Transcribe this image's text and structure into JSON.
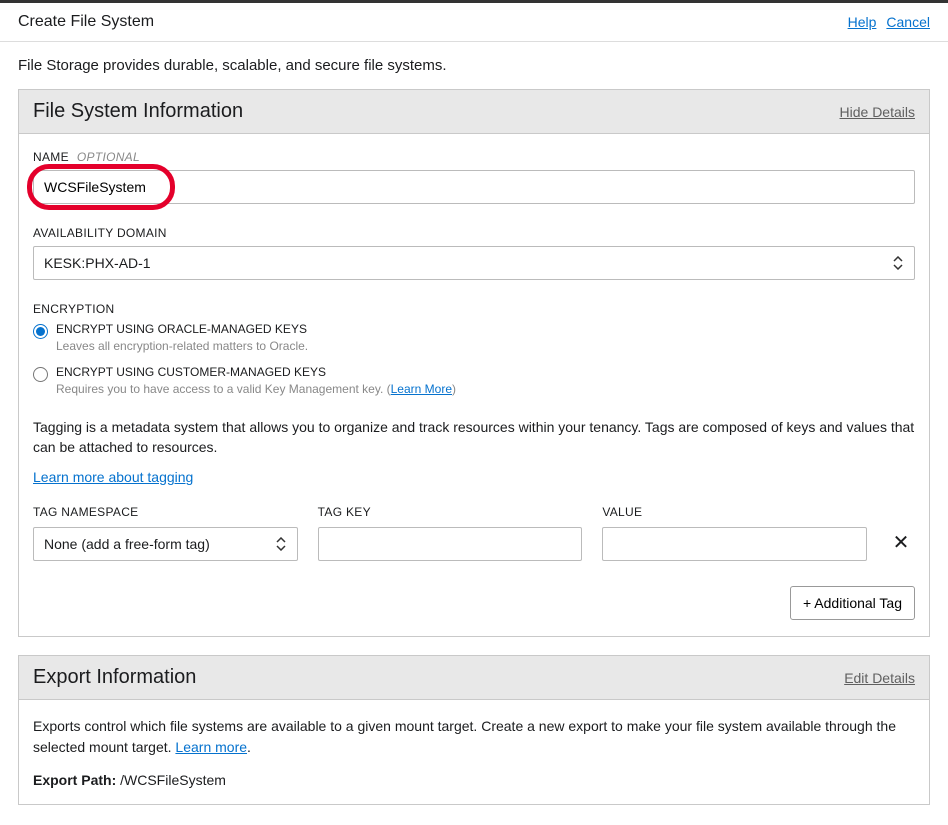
{
  "header": {
    "title": "Create File System",
    "help_label": "Help",
    "cancel_label": "Cancel"
  },
  "intro": "File Storage provides durable, scalable, and secure file systems.",
  "fs_section": {
    "title": "File System Information",
    "toggle_label": "Hide Details",
    "name": {
      "label": "NAME",
      "optional": "OPTIONAL",
      "value": "WCSFileSystem"
    },
    "availability_domain": {
      "label": "AVAILABILITY DOMAIN",
      "value": "KESK:PHX-AD-1"
    },
    "encryption": {
      "label": "ENCRYPTION",
      "options": [
        {
          "label": "ENCRYPT USING ORACLE-MANAGED KEYS",
          "description": "Leaves all encryption-related matters to Oracle."
        },
        {
          "label": "ENCRYPT USING CUSTOMER-MANAGED KEYS",
          "description": "Requires you to have access to a valid Key Management key. (",
          "learn_more": "Learn More",
          "closing": ")"
        }
      ]
    },
    "tagging": {
      "description": "Tagging is a metadata system that allows you to organize and track resources within your tenancy. Tags are composed of keys and values that can be attached to resources.",
      "learn_more": "Learn more about tagging",
      "namespace_label": "TAG NAMESPACE",
      "namespace_value": "None (add a free-form tag)",
      "key_label": "TAG KEY",
      "key_value": "",
      "value_label": "VALUE",
      "value_value": "",
      "additional_tag_button": "+ Additional Tag"
    }
  },
  "export_section": {
    "title": "Export Information",
    "toggle_label": "Edit Details",
    "description": "Exports control which file systems are available to a given mount target. Create a new export to make your file system available through the selected mount target. ",
    "learn_more": "Learn more",
    "learn_more_suffix": ".",
    "path_label": "Export Path: ",
    "path_value": "/WCSFileSystem"
  }
}
